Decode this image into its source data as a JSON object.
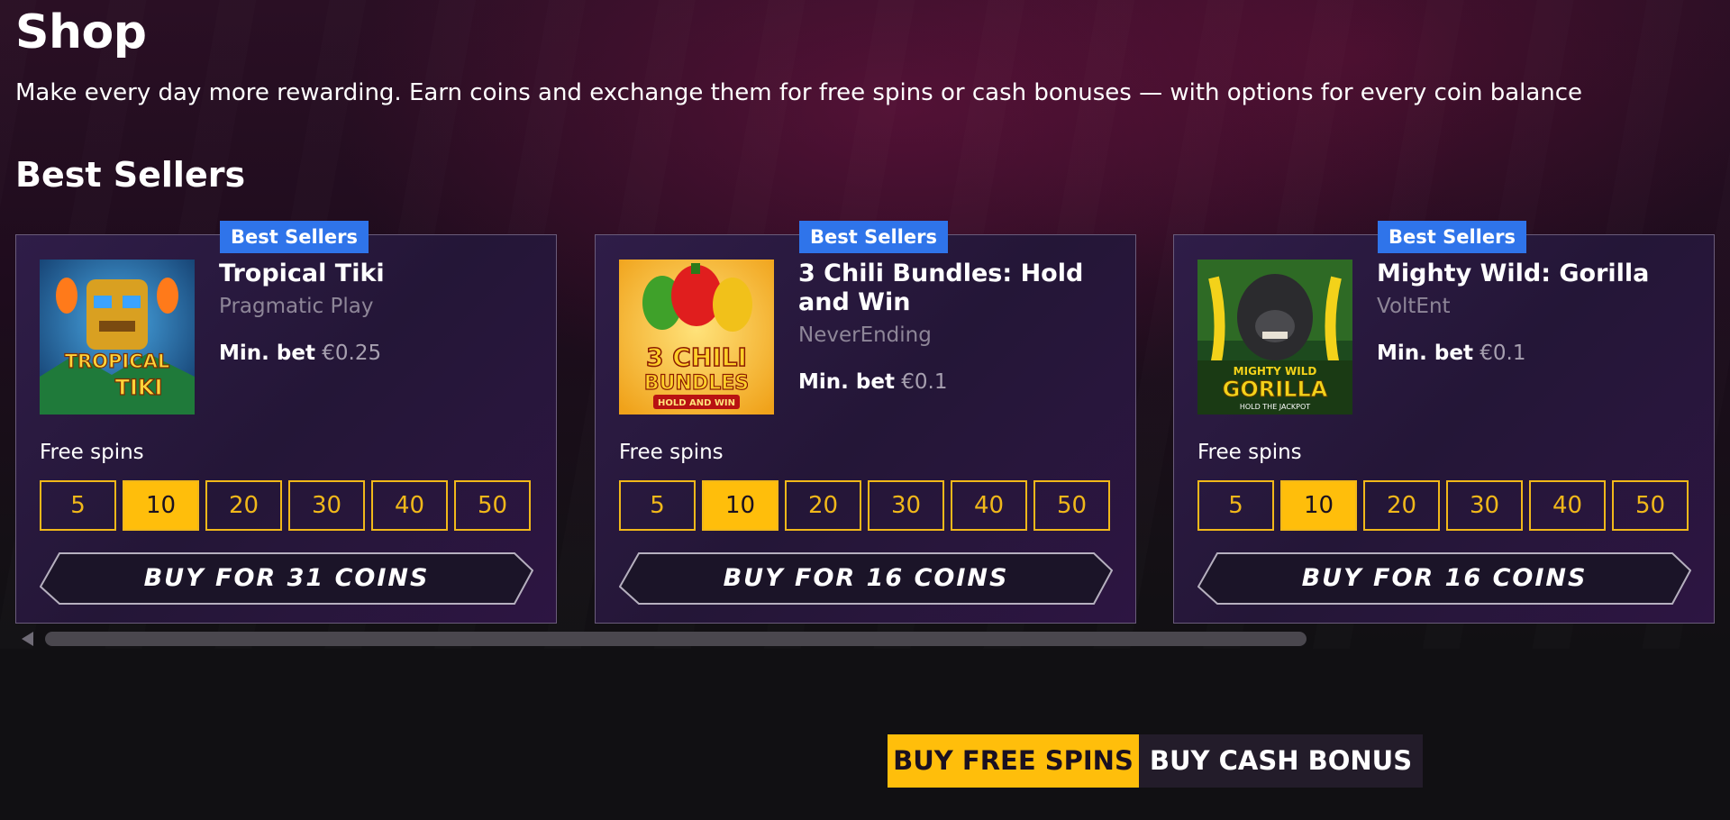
{
  "page": {
    "title": "Shop",
    "subtitle": "Make every day more rewarding. Earn coins and exchange them for free spins or cash bonuses — with options for every coin balance",
    "section_title": "Best Sellers"
  },
  "cards": [
    {
      "badge": "Best Sellers",
      "title": "Tropical Tiki",
      "provider": "Pragmatic Play",
      "minbet_label": "Min. bet",
      "minbet_value": "€0.25",
      "freespins_label": "Free spins",
      "spin_options": [
        "5",
        "10",
        "20",
        "30",
        "40",
        "50"
      ],
      "selected_spin": "10",
      "buy_label": "BUY FOR 31 COINS",
      "thumb_logo": [
        "TROPICAL",
        "TIKI"
      ]
    },
    {
      "badge": "Best Sellers",
      "title": "3 Chili Bundles: Hold and Win",
      "provider": "NeverEnding",
      "minbet_label": "Min. bet",
      "minbet_value": "€0.1",
      "freespins_label": "Free spins",
      "spin_options": [
        "5",
        "10",
        "20",
        "30",
        "40",
        "50"
      ],
      "selected_spin": "10",
      "buy_label": "BUY FOR 16 COINS",
      "thumb_logo": [
        "3 CHILI",
        "BUNDLES",
        "HOLD AND WIN"
      ]
    },
    {
      "badge": "Best Sellers",
      "title": "Mighty Wild: Gorilla",
      "provider": "VoltEnt",
      "minbet_label": "Min. bet",
      "minbet_value": "€0.1",
      "freespins_label": "Free spins",
      "spin_options": [
        "5",
        "10",
        "20",
        "30",
        "40",
        "50"
      ],
      "selected_spin": "10",
      "buy_label": "BUY FOR 16 COINS",
      "thumb_logo": [
        "MIGHTY WILD",
        "GORILLA",
        "HOLD THE JACKPOT"
      ]
    }
  ],
  "tabs": {
    "free_spins": "BUY FREE SPINS",
    "cash_bonus": "BUY CASH BONUS",
    "active": "BUY FREE SPINS"
  },
  "colors": {
    "accent_yellow": "#ffbe0b",
    "badge_blue": "#2f74ea",
    "card_bg": "#2a1a40",
    "page_bg": "#111013"
  },
  "icons": {
    "scroll_left": "triangle-left-icon"
  }
}
